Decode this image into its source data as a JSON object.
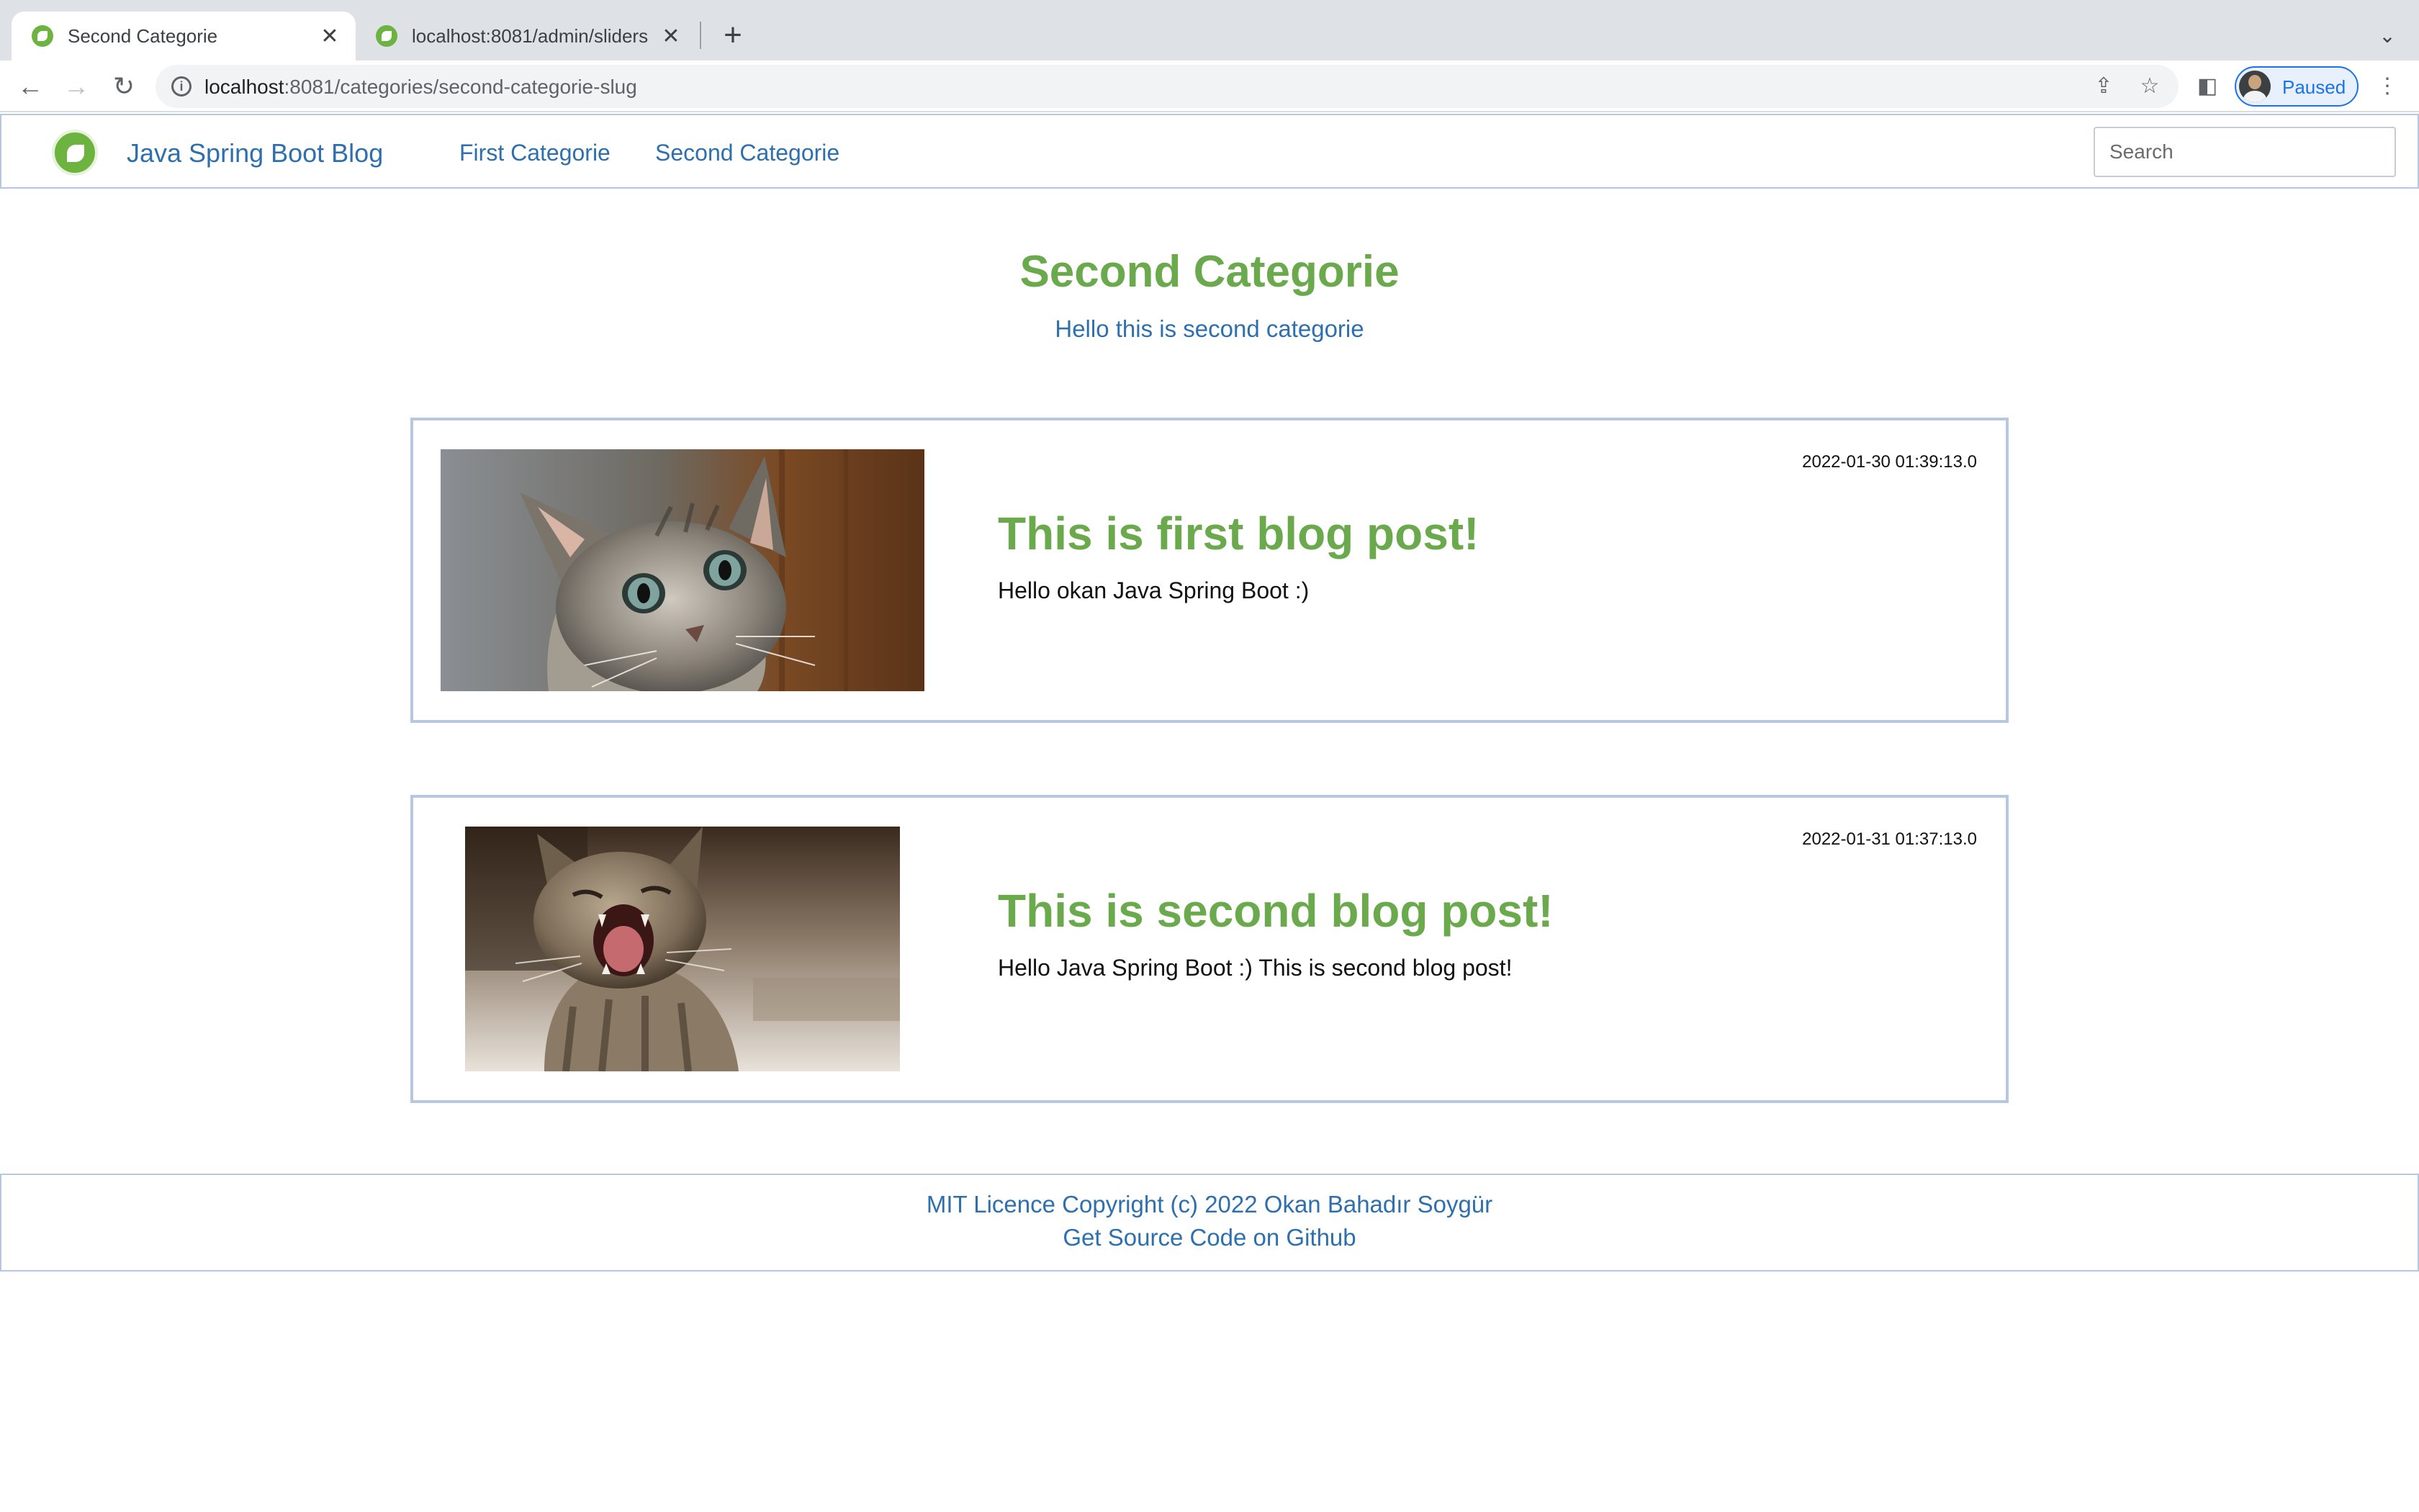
{
  "browser": {
    "tabs": [
      {
        "title": "Second Categorie",
        "active": true
      },
      {
        "title": "localhost:8081/admin/sliders",
        "active": false
      }
    ],
    "url_host": "localhost",
    "url_rest": ":8081/categories/second-categorie-slug",
    "profile_label": "Paused",
    "icons": {
      "back": "arrow-left-icon",
      "forward": "arrow-right-icon",
      "reload": "reload-icon",
      "share": "share-icon",
      "bookmark": "star-icon",
      "side_panel": "side-panel-icon",
      "menu": "kebab-menu-icon"
    }
  },
  "navbar": {
    "brand": "Java Spring Boot Blog",
    "links": [
      "First Categorie",
      "Second Categorie"
    ],
    "search_placeholder": "Search"
  },
  "category": {
    "title": "Second Categorie",
    "description": "Hello this is second categorie"
  },
  "posts": [
    {
      "date": "2022-01-30 01:39:13.0",
      "title": "This is first blog post!",
      "text": "Hello okan Java Spring Boot :)",
      "image": "kitten-looking-up-photo"
    },
    {
      "date": "2022-01-31 01:37:13.0",
      "title": "This is second blog post!",
      "text": "Hello Java Spring Boot :) This is second blog post!",
      "image": "kitten-yawning-photo"
    }
  ],
  "footer": {
    "copyright": "MIT Licence Copyright (c) 2022 Okan Bahadır Soygür",
    "source_link": "Get Source Code on Github"
  },
  "colors": {
    "accent_green": "#6aaa4c",
    "link_blue": "#2e6fad",
    "border_blue": "#b8c7e0"
  }
}
